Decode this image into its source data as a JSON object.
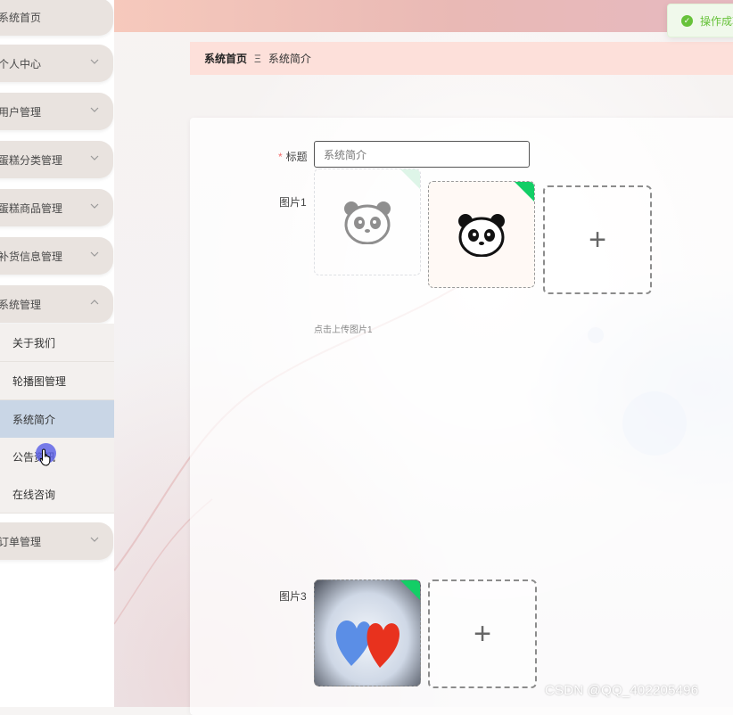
{
  "toast": {
    "text": "操作成功"
  },
  "sidebar": {
    "items": [
      {
        "label": "系统首页"
      },
      {
        "label": "个人中心"
      },
      {
        "label": "用户管理"
      },
      {
        "label": "蛋糕分类管理"
      },
      {
        "label": "蛋糕商品管理"
      },
      {
        "label": "补货信息管理"
      },
      {
        "label": "系统管理"
      },
      {
        "label": "订单管理"
      }
    ],
    "sub_items": [
      {
        "label": "关于我们"
      },
      {
        "label": "轮播图管理"
      },
      {
        "label": "系统简介"
      },
      {
        "label": "公告资讯"
      },
      {
        "label": "在线咨询"
      }
    ]
  },
  "breadcrumb": {
    "home": "系统首页",
    "separator": "Ξ",
    "current": "系统简介"
  },
  "form": {
    "title_label": "标题",
    "title_value": "系统简介",
    "picture1_label": "图片1",
    "picture1_hint": "点击上传图片1",
    "picture3_label": "图片3"
  },
  "icons": {
    "success": "check-circle-icon",
    "chevron": "chevron-down-icon",
    "plus": "plus-icon",
    "check": "check-icon"
  },
  "colors": {
    "success": "#67c23a",
    "upload_corner": "#13ce66",
    "active_submenu": "#c9d6e6",
    "breadcrumb_bg": "#fde0da",
    "required": "#f56c6c"
  },
  "watermark": "CSDN @QQ_402205496"
}
